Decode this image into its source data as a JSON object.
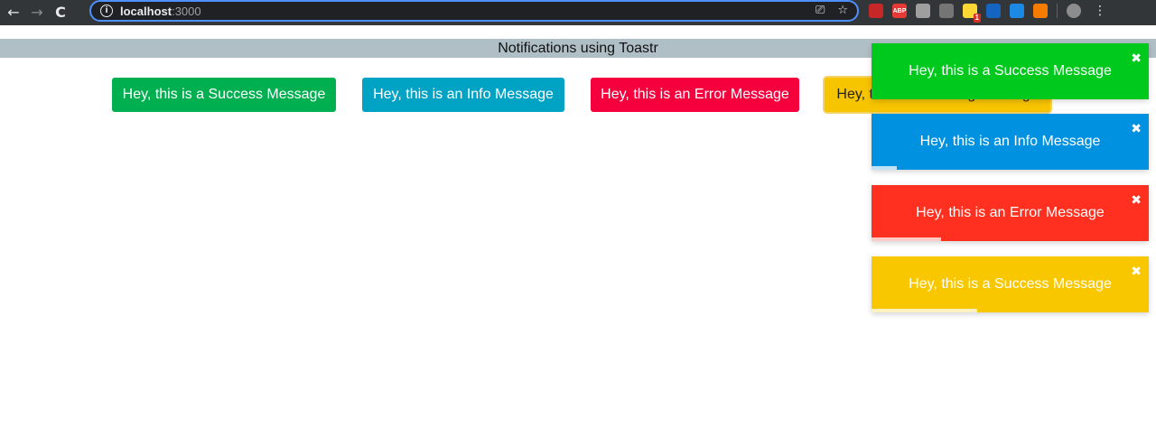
{
  "browser": {
    "nav": {
      "back": "←",
      "forward": "→",
      "reload": "C"
    },
    "url": {
      "info": "i",
      "host": "localhost",
      "port": ":3000"
    },
    "omnibox_icons": {
      "cast": "⎚",
      "star": "☆"
    },
    "extensions": [
      {
        "name": "ext-red-icon",
        "color": "#c62828",
        "label": ""
      },
      {
        "name": "adblock-plus-icon",
        "color": "#e53935",
        "label": "ABP"
      },
      {
        "name": "cube-icon",
        "color": "#9e9e9e",
        "label": ""
      },
      {
        "name": "eye-icon",
        "color": "#757575",
        "label": ""
      },
      {
        "name": "lightbulb-icon",
        "color": "#fdd835",
        "label": "",
        "badge": "1"
      },
      {
        "name": "chart-icon",
        "color": "#1565c0",
        "label": ""
      },
      {
        "name": "download-icon",
        "color": "#1e88e5",
        "label": ""
      },
      {
        "name": "fox-icon",
        "color": "#f57c00",
        "label": ""
      },
      {
        "name": "profile-avatar",
        "color": "#8d8d8d",
        "label": ""
      }
    ],
    "menu": "⋮"
  },
  "page": {
    "title": "Notifications using Toastr"
  },
  "buttons": [
    {
      "label": "Hey, this is a Success Message",
      "color": "#00b050"
    },
    {
      "label": "Hey, this is an Info Message",
      "color": "#00a3c4"
    },
    {
      "label": "Hey, this is an Error Message",
      "color": "#f5003c"
    },
    {
      "label": "Hey, this is a Warning Message",
      "color": "#f7c400"
    }
  ],
  "toasts": [
    {
      "message": "Hey, this is a Success Message",
      "color": "#00c91e",
      "close": "✖",
      "progress": 0
    },
    {
      "message": "Hey, this is an Info Message",
      "color": "#0092e0",
      "close": "✖",
      "progress": 0.09
    },
    {
      "message": "Hey, this is an Error Message",
      "color": "#ff3020",
      "close": "✖",
      "progress": 0.25
    },
    {
      "message": "Hey, this is a Success Message",
      "color": "#f9c700",
      "close": "✖",
      "progress": 0.38
    }
  ]
}
